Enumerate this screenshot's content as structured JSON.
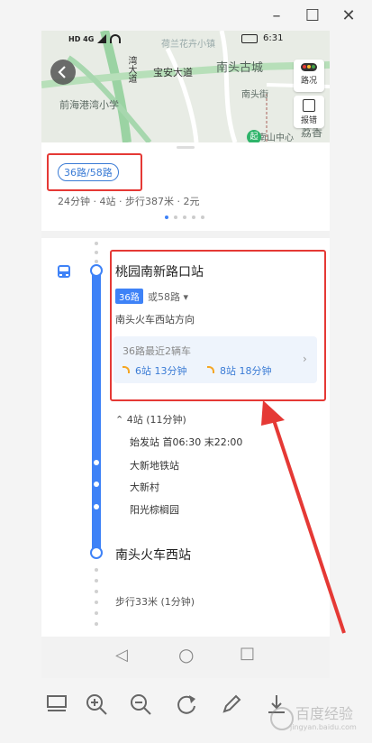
{
  "window": {
    "minimize_label": "–",
    "restore_label": "☐",
    "close_label": "✕"
  },
  "status_bar": {
    "left_icons": "HD 4G",
    "time": "6:31"
  },
  "map": {
    "labels": [
      "南头古城",
      "宝安大道",
      "前海港湾小学",
      "南头街",
      "南山中心",
      "荔香"
    ],
    "overlay_text": "荷兰花卉小镇",
    "road_labels": [
      "前海",
      "湾大道"
    ],
    "tools": {
      "traffic_label": "路况",
      "report_label": "报错"
    },
    "start_marker": "起"
  },
  "route_card": {
    "route_tag": "36路/58路",
    "summary": "24分钟 · 4站 · 步行387米 · 2元",
    "page_dots": 5,
    "active_dot": 0
  },
  "detail": {
    "board_station": "桃园南新路口站",
    "route_badge": "36路",
    "alt_route": "或58路 ▾",
    "direction": "南头火车西站方向",
    "arrival_title": "36路最近2辆车",
    "arrival_1": "6站 13分钟",
    "arrival_2": "8站 18分钟",
    "stops_toggle": "⌃ 4站 (11分钟)",
    "first_stop": "始发站  首06:30 末22:00",
    "stops": [
      "大新地铁站",
      "大新村",
      "阳光棕榈园"
    ],
    "alight_station": "南头火车西站",
    "walk": "步行33米 (1分钟)"
  },
  "nav_bar": {
    "back_icon": "◁",
    "home_icon": "○",
    "recent_icon": "□"
  },
  "toolbar": {
    "items": [
      "layout-icon",
      "zoom-in-icon",
      "zoom-out-icon",
      "rotate-icon",
      "edit-icon",
      "download-icon"
    ]
  },
  "watermark": "百度经验",
  "watermark_url": "jingyan.baidu.com",
  "colors": {
    "accent": "#3e82f7",
    "annotation": "#e53935",
    "realtime": "#f5a623"
  }
}
